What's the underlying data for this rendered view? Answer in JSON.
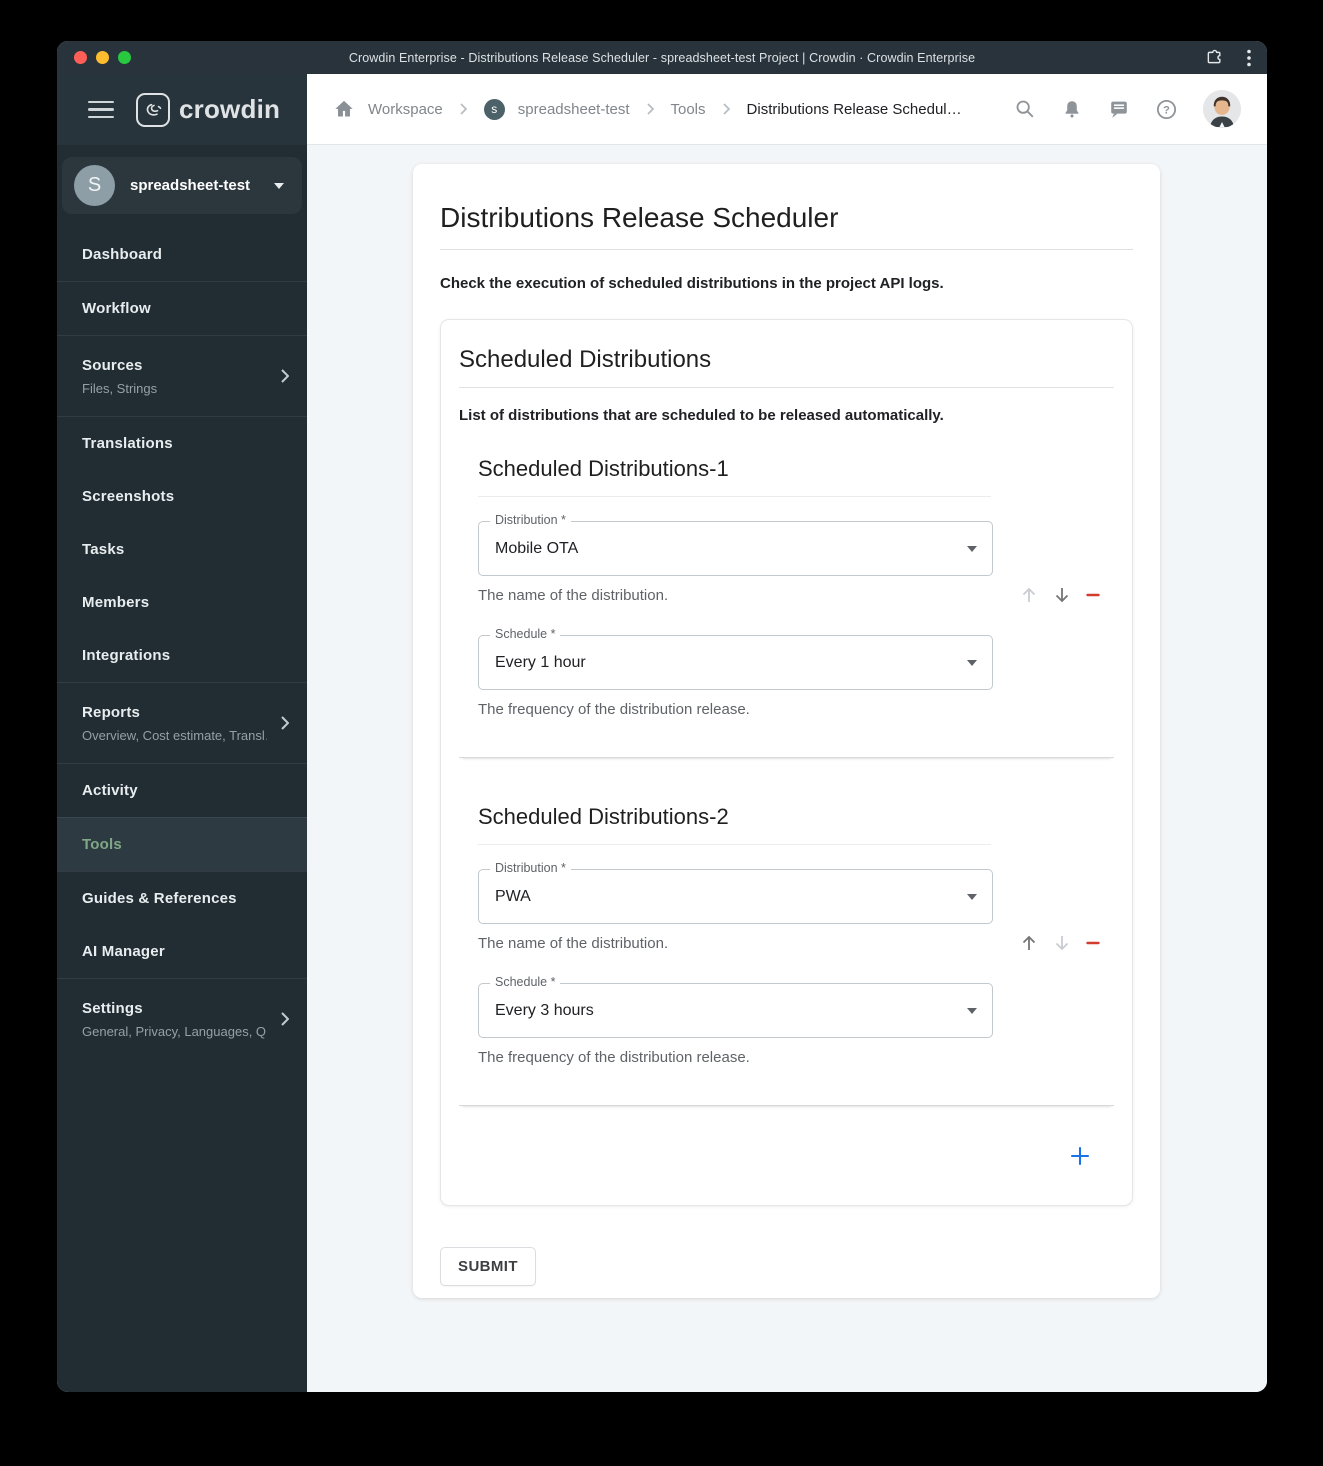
{
  "titlebar": {
    "title": "Crowdin Enterprise - Distributions Release Scheduler - spreadsheet-test Project | Crowdin · Crowdin Enterprise"
  },
  "brand": {
    "wordmark": "crowdin"
  },
  "project_selector": {
    "initial": "S",
    "name": "spreadsheet-test"
  },
  "sidebar": {
    "items": [
      {
        "label": "Dashboard"
      },
      {
        "label": "Workflow"
      },
      {
        "label": "Sources",
        "subtitle": "Files, Strings"
      },
      {
        "label": "Translations"
      },
      {
        "label": "Screenshots"
      },
      {
        "label": "Tasks"
      },
      {
        "label": "Members"
      },
      {
        "label": "Integrations"
      },
      {
        "label": "Reports",
        "subtitle": "Overview, Cost estimate, Transl…"
      },
      {
        "label": "Activity"
      },
      {
        "label": "Tools"
      },
      {
        "label": "Guides & References"
      },
      {
        "label": "AI Manager"
      },
      {
        "label": "Settings",
        "subtitle": "General, Privacy, Languages, Q…"
      }
    ]
  },
  "breadcrumb": {
    "workspace_label": "Workspace",
    "project_initial": "s",
    "project_label": "spreadsheet-test",
    "tools_label": "Tools",
    "current_label": "Distributions Release Schedul…"
  },
  "main": {
    "title": "Distributions Release Scheduler",
    "description": "Check the execution of scheduled distributions in the project API logs.",
    "panel": {
      "title": "Scheduled Distributions",
      "description": "List of distributions that are scheduled to be released automatically.",
      "groups": [
        {
          "title": "Scheduled Distributions-1",
          "fields": [
            {
              "label": "Distribution *",
              "value": "Mobile OTA",
              "helper": "The name of the distribution."
            },
            {
              "label": "Schedule *",
              "value": "Every 1 hour",
              "helper": "The frequency of the distribution release."
            }
          ]
        },
        {
          "title": "Scheduled Distributions-2",
          "fields": [
            {
              "label": "Distribution *",
              "value": "PWA",
              "helper": "The name of the distribution."
            },
            {
              "label": "Schedule *",
              "value": "Every 3 hours",
              "helper": "The frequency of the distribution release."
            }
          ]
        }
      ]
    },
    "submit_label": "SUBMIT"
  },
  "icons": {
    "names": [
      "hamburger-icon",
      "crowdin-logo",
      "home-icon",
      "chevron-right-icon",
      "search-icon",
      "bell-icon",
      "chat-icon",
      "help-icon",
      "arrow-up-icon",
      "arrow-down-icon",
      "remove-icon",
      "add-icon",
      "extensions-icon",
      "kebab-menu-icon",
      "caret-down-icon"
    ]
  },
  "colors": {
    "accent_green": "#81a886",
    "remove_red": "#d23b2e",
    "add_blue": "#1a73e8",
    "sidebar_bg": "#222d33",
    "titlebar_bg": "#28333b"
  }
}
